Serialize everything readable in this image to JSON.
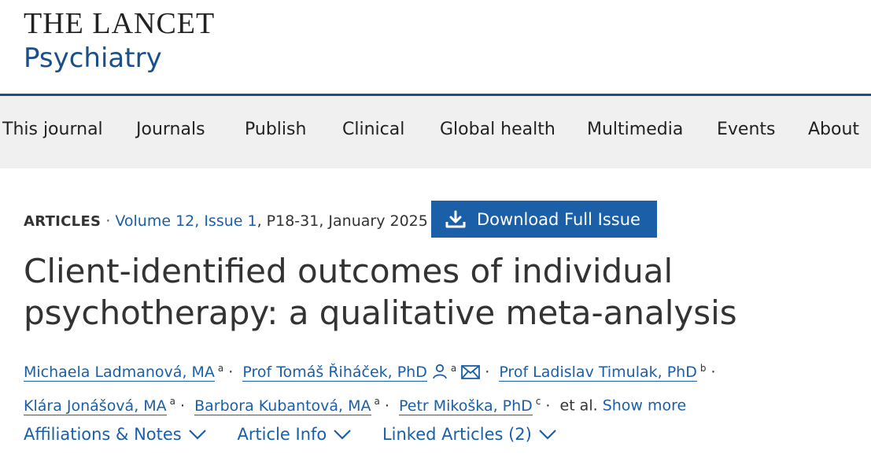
{
  "logo": {
    "title": "THE LANCET",
    "subtitle": "Psychiatry"
  },
  "nav": {
    "items": [
      "This journal",
      "Journals",
      "Publish",
      "Clinical",
      "Global health",
      "Multimedia",
      "Events",
      "About"
    ]
  },
  "article": {
    "type": "ARTICLES",
    "volume_link": "Volume 12, Issue 1",
    "pages_date": ", P18-31, January 2025",
    "download_label": "Download Full Issue",
    "title": "Client-identified outcomes of individual psychotherapy: a qualitative meta-analysis"
  },
  "authors": {
    "list": [
      {
        "name": "Michaela Ladmanová, MA",
        "aff": "a"
      },
      {
        "name": "Prof Tomáš Řiháček, PhD",
        "aff": "a"
      },
      {
        "name": "Prof Ladislav Timulak, PhD",
        "aff": "b"
      },
      {
        "name": "Klára Jonášová, MA",
        "aff": "a"
      },
      {
        "name": "Barbora Kubantová, MA",
        "aff": "a"
      },
      {
        "name": "Petr Mikoška, PhD",
        "aff": "c"
      }
    ],
    "etal": "et al.",
    "show_more": "Show more"
  },
  "tabs": [
    "Affiliations & Notes",
    "Article Info",
    "Linked Articles (2)"
  ],
  "colors": {
    "brand": "#1b4f8a",
    "link": "#1b5fa8",
    "nav_bg": "#f0f0f0"
  },
  "icons": {
    "person": "person-icon",
    "mail": "mail-icon",
    "download": "download-icon",
    "chevron": "chevron-down-icon"
  }
}
